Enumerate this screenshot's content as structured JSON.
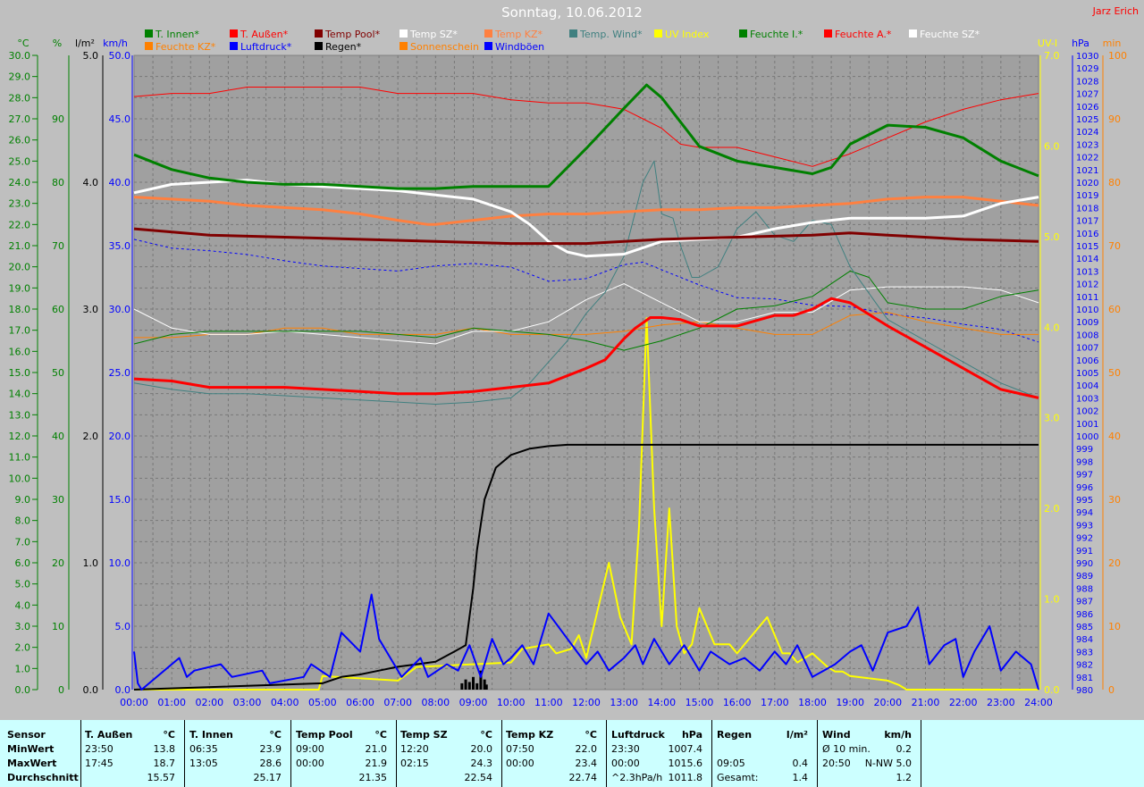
{
  "title": "Sonntag, 10.06.2012",
  "author": "Jarz Erich",
  "chart_data": {
    "type": "line",
    "x_ticks": [
      "00:00",
      "01:00",
      "02:00",
      "03:00",
      "04:00",
      "05:00",
      "06:00",
      "07:00",
      "08:00",
      "09:00",
      "10:00",
      "11:00",
      "12:00",
      "13:00",
      "14:00",
      "15:00",
      "16:00",
      "17:00",
      "18:00",
      "19:00",
      "20:00",
      "21:00",
      "22:00",
      "23:00",
      "24:00"
    ],
    "axes": {
      "celsius": {
        "label": "°C",
        "color": "#008000",
        "min": 0,
        "max": 30,
        "step": 1
      },
      "percent": {
        "label": "%",
        "color": "#008000",
        "min": 0,
        "max": 100,
        "step": 10
      },
      "rain": {
        "label": "l/m²",
        "color": "#000000",
        "min": 0,
        "max": 5,
        "step": 1
      },
      "kmh": {
        "label": "km/h",
        "color": "#0000ff",
        "min": 0,
        "max": 50,
        "step": 5
      },
      "uv": {
        "label": "UV-I",
        "color": "#ffff00",
        "min": 0,
        "max": 7,
        "step": 1
      },
      "hpa": {
        "label": "hPa",
        "color": "#0000ff",
        "min": 980,
        "max": 1030,
        "step": 1
      },
      "min": {
        "label": "min",
        "color": "#ff8000",
        "min": 0,
        "max": 100,
        "step": 10
      }
    },
    "legend": [
      {
        "name": "T. Innen*",
        "color": "#008000"
      },
      {
        "name": "T. Außen*",
        "color": "#ff0000"
      },
      {
        "name": "Temp Pool*",
        "color": "#800000"
      },
      {
        "name": "Temp SZ*",
        "color": "#ffffff"
      },
      {
        "name": "Temp KZ*",
        "color": "#ff8040"
      },
      {
        "name": "Temp. Wind*",
        "color": "#408080"
      },
      {
        "name": "UV Index",
        "color": "#ffff00"
      },
      {
        "name": "Feuchte I.*",
        "color": "#008000"
      },
      {
        "name": "Feuchte A.*",
        "color": "#ff0000"
      },
      {
        "name": "Feuchte SZ*",
        "color": "#ffffff"
      },
      {
        "name": "Feuchte KZ*",
        "color": "#ff8000"
      },
      {
        "name": "Luftdruck*",
        "color": "#0000ff"
      },
      {
        "name": "Regen*",
        "color": "#000000"
      },
      {
        "name": "Sonnenschein",
        "color": "#ff8000"
      },
      {
        "name": "Windböen",
        "color": "#0000ff"
      }
    ],
    "series": [
      {
        "name": "T. Innen*",
        "axis": "celsius",
        "color": "#008000",
        "width": 3,
        "x": [
          0,
          1,
          2,
          3,
          4,
          5,
          6,
          7,
          8,
          9,
          10,
          11,
          12,
          13,
          13.6,
          14,
          15,
          16,
          17,
          18,
          18.5,
          19,
          20,
          21,
          22,
          23,
          24
        ],
        "y": [
          25.3,
          24.6,
          24.2,
          24.0,
          23.9,
          23.9,
          23.8,
          23.7,
          23.7,
          23.8,
          23.8,
          23.8,
          25.6,
          27.5,
          28.6,
          28.0,
          25.7,
          25.0,
          24.7,
          24.4,
          24.7,
          25.8,
          26.7,
          26.6,
          26.1,
          25.0,
          24.3
        ]
      },
      {
        "name": "T. Außen*",
        "axis": "celsius",
        "color": "#ff0000",
        "width": 3,
        "x": [
          0,
          1,
          2,
          3,
          4,
          5,
          6,
          7,
          8,
          9,
          10,
          11,
          12,
          12.5,
          13,
          13.3,
          13.7,
          14,
          14.5,
          15,
          16,
          17,
          17.5,
          18,
          18.5,
          19,
          20,
          21,
          22,
          23,
          24
        ],
        "y": [
          14.7,
          14.6,
          14.3,
          14.3,
          14.3,
          14.2,
          14.1,
          14.0,
          14.0,
          14.1,
          14.3,
          14.5,
          15.2,
          15.6,
          16.6,
          17.1,
          17.6,
          17.6,
          17.5,
          17.2,
          17.2,
          17.7,
          17.7,
          18.0,
          18.5,
          18.3,
          17.2,
          16.2,
          15.2,
          14.2,
          13.8
        ]
      },
      {
        "name": "Temp Pool*",
        "axis": "celsius",
        "color": "#800000",
        "width": 3,
        "x": [
          0,
          2,
          4,
          6,
          8,
          10,
          12,
          14,
          16,
          18,
          19,
          20,
          22,
          24
        ],
        "y": [
          21.8,
          21.5,
          21.4,
          21.3,
          21.2,
          21.1,
          21.1,
          21.3,
          21.4,
          21.5,
          21.6,
          21.5,
          21.3,
          21.2
        ]
      },
      {
        "name": "Temp SZ*",
        "axis": "celsius",
        "color": "#ffffff",
        "width": 3,
        "x": [
          0,
          1,
          2,
          3,
          4,
          5,
          6,
          7,
          8,
          9,
          10,
          10.5,
          11,
          11.5,
          12,
          13,
          14,
          15,
          16,
          17,
          18,
          19,
          20,
          21,
          22,
          23,
          24
        ],
        "y": [
          23.5,
          23.9,
          24.0,
          24.1,
          23.9,
          23.8,
          23.7,
          23.6,
          23.4,
          23.2,
          22.6,
          22.0,
          21.2,
          20.7,
          20.5,
          20.6,
          21.2,
          21.3,
          21.4,
          21.8,
          22.1,
          22.3,
          22.3,
          22.3,
          22.4,
          23.0,
          23.3
        ]
      },
      {
        "name": "Temp KZ*",
        "axis": "celsius",
        "color": "#ff8040",
        "width": 3,
        "x": [
          0,
          1,
          2,
          3,
          4,
          5,
          6,
          7,
          7.8,
          8,
          9,
          10,
          11,
          12,
          13,
          14,
          15,
          16,
          17,
          18,
          19,
          20,
          21,
          22,
          23,
          24
        ],
        "y": [
          23.3,
          23.2,
          23.1,
          22.9,
          22.8,
          22.7,
          22.5,
          22.2,
          22.0,
          22.0,
          22.2,
          22.4,
          22.5,
          22.5,
          22.6,
          22.7,
          22.7,
          22.8,
          22.8,
          22.9,
          23.0,
          23.2,
          23.3,
          23.3,
          23.1,
          22.9
        ]
      },
      {
        "name": "Temp. Wind*",
        "axis": "celsius",
        "color": "#408080",
        "width": 1,
        "x": [
          0,
          1,
          2,
          3,
          4,
          5,
          6,
          7,
          8,
          9,
          10,
          10.5,
          11,
          11.5,
          12,
          12.5,
          13,
          13.5,
          13.8,
          14,
          14.3,
          14.5,
          14.8,
          15,
          15.5,
          16,
          16.5,
          17,
          17.5,
          18,
          18.5,
          19,
          20,
          21,
          22,
          23,
          24
        ],
        "y": [
          14.5,
          14.2,
          14.0,
          14.0,
          13.9,
          13.8,
          13.7,
          13.6,
          13.5,
          13.6,
          13.8,
          14.5,
          15.5,
          16.5,
          17.8,
          18.8,
          20.5,
          24.0,
          25.0,
          22.5,
          22.3,
          21.0,
          19.5,
          19.5,
          20.0,
          21.8,
          22.6,
          21.5,
          21.2,
          22.2,
          22.0,
          20.0,
          17.5,
          16.5,
          15.5,
          14.5,
          13.8
        ]
      },
      {
        "name": "Feuchte I.*",
        "axis": "percent",
        "color": "#008000",
        "width": 1,
        "x": [
          0,
          1,
          2,
          3,
          4,
          5,
          6,
          7,
          8,
          9,
          10,
          11,
          12,
          13,
          14,
          15,
          16,
          17,
          18,
          19,
          19.5,
          20,
          21,
          22,
          23,
          24
        ],
        "y": [
          54.5,
          56,
          56.5,
          56.5,
          56.5,
          56.5,
          56.5,
          56,
          55.5,
          57,
          56.5,
          56,
          55,
          53.5,
          55,
          57,
          60,
          60.5,
          62,
          66,
          65,
          61,
          60,
          60,
          62,
          63
        ]
      },
      {
        "name": "Feuchte A.*",
        "axis": "percent",
        "color": "#ff0000",
        "width": 1,
        "x": [
          0,
          1,
          2,
          3,
          4,
          5,
          6,
          7,
          8,
          9,
          10,
          11,
          12,
          12.5,
          13,
          13.5,
          14,
          14.5,
          15,
          16,
          17,
          18,
          19,
          20,
          21,
          22,
          23,
          24
        ],
        "y": [
          93.5,
          94,
          94,
          95,
          95,
          95,
          95,
          94,
          94,
          94,
          93,
          92.5,
          92.5,
          92,
          91.5,
          90,
          88.5,
          86,
          85.5,
          85.5,
          84,
          82.5,
          84.5,
          87,
          89.5,
          91.5,
          93,
          94
        ]
      },
      {
        "name": "Feuchte SZ*",
        "axis": "percent",
        "color": "#ffffff",
        "width": 1,
        "x": [
          0,
          1,
          2,
          3,
          4,
          5,
          6,
          7,
          8,
          9,
          10,
          11,
          12,
          13,
          14,
          15,
          16,
          17,
          18,
          19,
          20,
          21,
          22,
          23,
          24
        ],
        "y": [
          60,
          57,
          56,
          56,
          56.5,
          56,
          55.5,
          55,
          54.5,
          56.5,
          56.5,
          58,
          61.5,
          64,
          61,
          58,
          58,
          59.5,
          59.5,
          63,
          63.5,
          63.5,
          63.5,
          63,
          61
        ]
      },
      {
        "name": "Feuchte KZ*",
        "axis": "percent",
        "color": "#ff8000",
        "width": 1,
        "x": [
          0,
          1,
          2,
          3,
          4,
          5,
          6,
          7,
          8,
          9,
          10,
          11,
          12,
          13,
          14,
          15,
          16,
          17,
          18,
          19,
          20,
          21,
          22,
          23,
          24
        ],
        "y": [
          55.5,
          55.5,
          56,
          56,
          57,
          57,
          56,
          56,
          56,
          57,
          56,
          56,
          56,
          56.5,
          57.5,
          58,
          57,
          56,
          56,
          59,
          59.5,
          58,
          57,
          56,
          56
        ]
      },
      {
        "name": "Luftdruck*",
        "axis": "hpa",
        "color": "#0000ff",
        "width": 1,
        "dash": true,
        "x": [
          0,
          1,
          2,
          3,
          4,
          5,
          6,
          7,
          8,
          9,
          10,
          11,
          12,
          13,
          13.5,
          14,
          15,
          16,
          17,
          18,
          19,
          20,
          21,
          22,
          23,
          24
        ],
        "y": [
          1015.5,
          1014.8,
          1014.6,
          1014.3,
          1013.8,
          1013.4,
          1013.2,
          1013.0,
          1013.4,
          1013.6,
          1013.3,
          1012.2,
          1012.4,
          1013.5,
          1013.7,
          1013.1,
          1011.9,
          1010.9,
          1010.8,
          1010.3,
          1010.2,
          1009.6,
          1009.3,
          1008.8,
          1008.4,
          1007.4
        ]
      },
      {
        "name": "UV Index",
        "axis": "uv",
        "color": "#ffff00",
        "width": 2,
        "x": [
          0,
          4.9,
          5,
          7,
          7.5,
          10,
          10.3,
          11,
          11.2,
          11.6,
          11.8,
          12,
          12.6,
          12.9,
          13.2,
          13.4,
          13.6,
          13.8,
          14,
          14.2,
          14.4,
          14.6,
          14.8,
          15,
          15.4,
          15.8,
          16,
          16.4,
          16.8,
          17.2,
          17.4,
          17.6,
          18,
          18.4,
          18.6,
          18.8,
          19,
          20,
          20.3,
          20.5,
          24
        ],
        "y": [
          0,
          0,
          0.15,
          0.1,
          0.25,
          0.3,
          0.45,
          0.5,
          0.4,
          0.45,
          0.6,
          0.35,
          1.4,
          0.8,
          0.5,
          1.8,
          4.1,
          2.0,
          0.7,
          2.0,
          0.7,
          0.4,
          0.5,
          0.9,
          0.5,
          0.5,
          0.4,
          0.6,
          0.8,
          0.4,
          0.4,
          0.3,
          0.4,
          0.25,
          0.2,
          0.2,
          0.15,
          0.1,
          0.05,
          0,
          0
        ]
      },
      {
        "name": "Regen*",
        "axis": "rain",
        "color": "#000000",
        "width": 2,
        "x": [
          0,
          5,
          5.5,
          6,
          6.5,
          7,
          7.5,
          8,
          8.5,
          8.8,
          9,
          9.1,
          9.2,
          9.3,
          9.6,
          10,
          10.5,
          11,
          11.5,
          12,
          24
        ],
        "y": [
          0,
          0.05,
          0.1,
          0.12,
          0.15,
          0.18,
          0.2,
          0.22,
          0.3,
          0.35,
          0.8,
          1.1,
          1.3,
          1.5,
          1.75,
          1.85,
          1.9,
          1.92,
          1.93,
          1.93,
          1.93
        ]
      },
      {
        "name": "Windböen",
        "axis": "kmh",
        "color": "#0000ff",
        "width": 2,
        "x": [
          0,
          0.1,
          0.2,
          1.2,
          1.4,
          1.6,
          2.3,
          2.6,
          3.4,
          3.6,
          4.5,
          4.7,
          5.2,
          5.5,
          6,
          6.3,
          6.5,
          6.7,
          7.1,
          7.6,
          7.8,
          8.3,
          8.6,
          8.9,
          9.2,
          9.5,
          9.8,
          10,
          10.3,
          10.6,
          11,
          11.5,
          12,
          12.3,
          12.6,
          13,
          13.3,
          13.5,
          13.8,
          14.2,
          14.6,
          15,
          15.3,
          15.8,
          16.2,
          16.6,
          17,
          17.3,
          17.6,
          18,
          18.3,
          18.6,
          19,
          19.3,
          19.6,
          20,
          20.5,
          20.8,
          21.1,
          21.5,
          21.8,
          22,
          22.3,
          22.7,
          23,
          23.4,
          23.8,
          24
        ],
        "y": [
          3,
          0.5,
          0,
          2.5,
          1.0,
          1.5,
          2,
          1,
          1.5,
          0.5,
          1,
          2,
          1,
          4.5,
          3,
          7.5,
          4,
          3,
          1,
          2.5,
          1,
          2,
          1.5,
          3.5,
          1,
          4,
          2,
          2.5,
          3.5,
          2,
          6,
          4,
          2,
          3,
          1.5,
          2.5,
          3.5,
          2,
          4,
          2,
          3.5,
          1.5,
          3,
          2,
          2.5,
          1.5,
          3,
          2,
          3.5,
          1,
          1.5,
          2,
          3,
          3.5,
          1.5,
          4.5,
          5,
          6.5,
          2,
          3.5,
          4,
          1,
          3,
          5,
          1.5,
          3,
          2,
          0
        ]
      }
    ],
    "bars": {
      "name": "Regen*",
      "axis": "rain",
      "color": "#000000",
      "x": [
        8.7,
        8.8,
        8.9,
        9.0,
        9.1,
        9.2,
        9.3,
        9.35
      ],
      "values": [
        0.05,
        0.08,
        0.06,
        0.1,
        0.05,
        0.15,
        0.08,
        0.04
      ]
    },
    "stats": {
      "headers": [
        "Sensor",
        "T. Außen",
        "°C",
        "T. Innen",
        "°C",
        "Temp Pool",
        "°C",
        "Temp SZ",
        "°C",
        "Temp KZ",
        "°C",
        "Luftdruck",
        "hPa",
        "Regen",
        "l/m²",
        "Wind",
        "km/h"
      ],
      "rows": [
        {
          "label": "MinWert",
          "cells": [
            "23:50",
            "13.8",
            "06:35",
            "23.9",
            "09:00",
            "21.0",
            "12:20",
            "20.0",
            "07:50",
            "22.0",
            "23:30",
            "1007.4",
            "",
            "",
            "Ø 10 min.",
            "0.2"
          ]
        },
        {
          "label": "MaxWert",
          "cells": [
            "17:45",
            "18.7",
            "13:05",
            "28.6",
            "00:00",
            "21.9",
            "02:15",
            "24.3",
            "00:00",
            "23.4",
            "00:00",
            "1015.6",
            "09:05",
            "0.4",
            "20:50",
            "N-NW 5.0"
          ]
        },
        {
          "label": "Durchschnitt",
          "cells": [
            "",
            "15.57",
            "",
            "25.17",
            "",
            "21.35",
            "",
            "22.54",
            "",
            "22.74",
            "^2.3hPa/h",
            "1011.8",
            "Gesamt:",
            "1.4",
            "",
            "1.2"
          ]
        }
      ]
    }
  }
}
